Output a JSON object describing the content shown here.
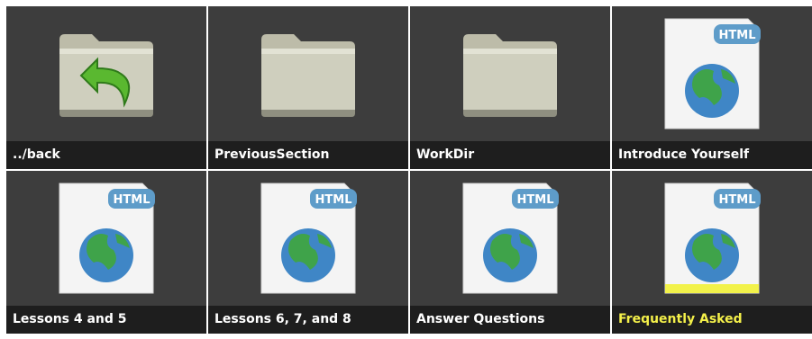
{
  "tiles": [
    {
      "label": "../back",
      "icon": "folder-back-icon"
    },
    {
      "label": "PreviousSection",
      "icon": "folder-icon"
    },
    {
      "label": "WorkDir",
      "icon": "folder-icon"
    },
    {
      "label": "Introduce Yourself",
      "icon": "html-file-icon",
      "badge": "HTML"
    },
    {
      "label": "Lessons 4 and 5",
      "icon": "html-file-icon",
      "badge": "HTML"
    },
    {
      "label": "Lessons 6, 7, and 8",
      "icon": "html-file-icon",
      "badge": "HTML"
    },
    {
      "label": "Answer Questions",
      "icon": "html-file-icon",
      "badge": "HTML"
    },
    {
      "label": "Frequently Asked",
      "icon": "html-file-icon",
      "badge": "HTML",
      "highlighted": true
    }
  ],
  "colors": {
    "tile_bg": "#3d3d3d",
    "label_bg": "#1e1e1e",
    "label_text": "#ffffff",
    "highlight_text": "#f4f04a",
    "highlight_bar": "#f2f24a"
  }
}
